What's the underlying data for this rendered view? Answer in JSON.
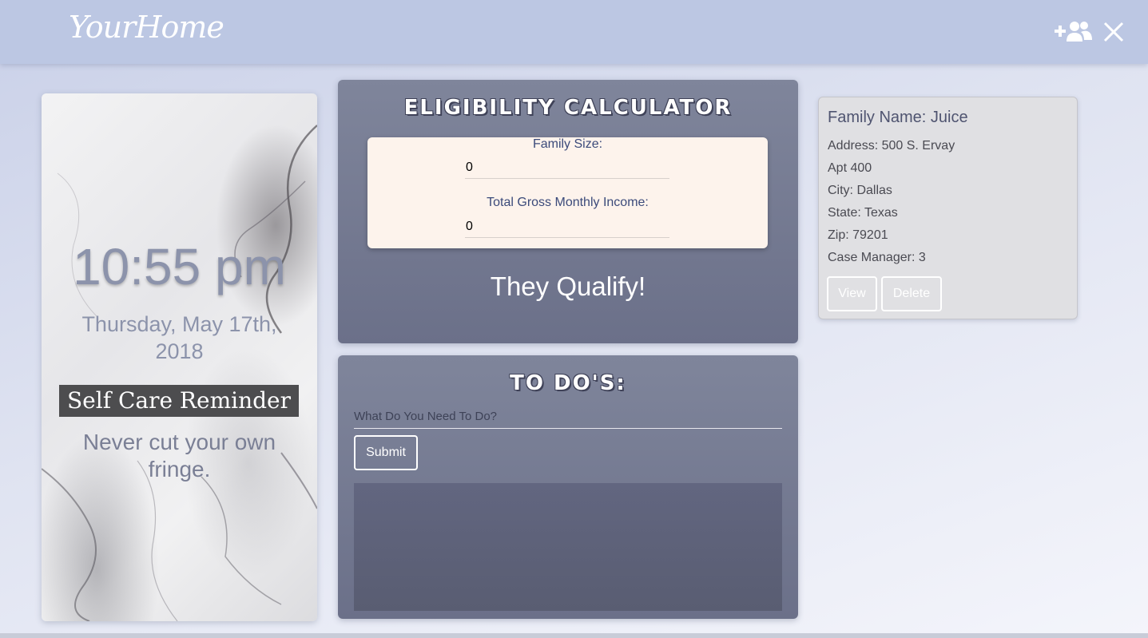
{
  "navbar": {
    "brand": "YourHome",
    "add_user_icon": "add-group-icon",
    "close_icon": "close-icon"
  },
  "clock": {
    "time": "10:55 pm",
    "date": "Thursday, May 17th, 2018",
    "reminder_title": "Self Care Reminder",
    "reminder_text": "Never cut your own fringe."
  },
  "eligibility": {
    "heading": "ELIGIBILITY CALCULATOR",
    "family_size_label": "Family Size:",
    "family_size_value": "0",
    "income_label": "Total Gross Monthly Income:",
    "income_value": "0",
    "result": "They Qualify!"
  },
  "todo": {
    "heading": "TO DO'S:",
    "placeholder": "What Do You Need To Do?",
    "submit_label": "Submit"
  },
  "family": {
    "name": "Family Name: Juice",
    "address": "Address: 500 S. Ervay",
    "apt": "Apt 400",
    "city": "City: Dallas",
    "state": "State: Texas",
    "zip": "Zip: 79201",
    "case_manager": "Case Manager: 3",
    "view_label": "View",
    "delete_label": "Delete"
  },
  "colors": {
    "navbar": "#bcc7e3",
    "card": "#767b93",
    "form_bg": "#fdf3ec",
    "family_card": "#e0e0e3"
  }
}
